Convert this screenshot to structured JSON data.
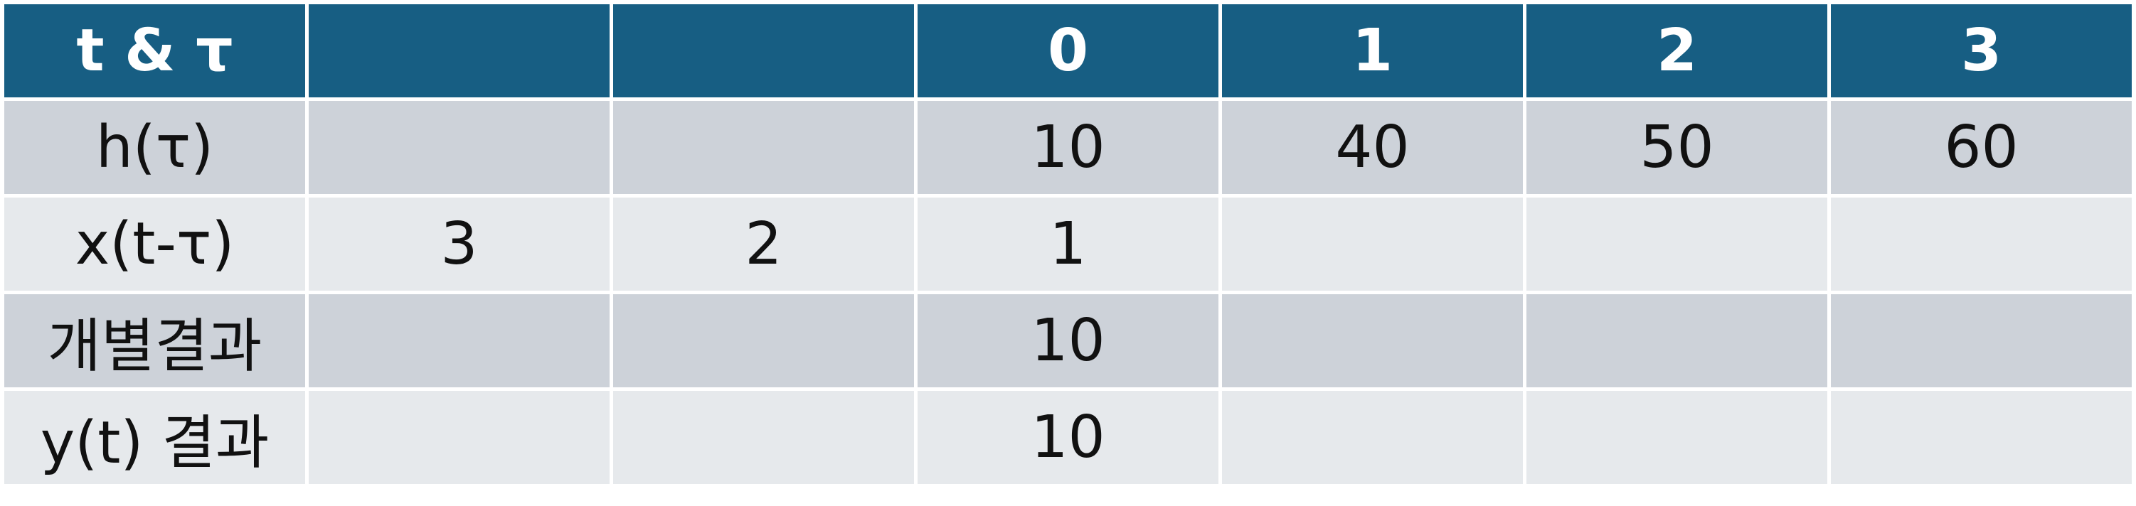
{
  "header": [
    "t & τ",
    "",
    "",
    "0",
    "1",
    "2",
    "3"
  ],
  "rows": [
    {
      "label": "h(τ)",
      "cells": [
        "",
        "",
        "10",
        "40",
        "50",
        "60"
      ]
    },
    {
      "label": "x(t-τ)",
      "cells": [
        "3",
        "2",
        "1",
        "",
        "",
        ""
      ]
    },
    {
      "label": "개별결과",
      "cells": [
        "",
        "",
        "10",
        "",
        "",
        ""
      ]
    },
    {
      "label": "y(t) 결과",
      "cells": [
        "",
        "",
        "10",
        "",
        "",
        ""
      ]
    }
  ],
  "colors": {
    "header_bg": "#175e83",
    "header_text": "#ffffff",
    "band_dark": "#cdd2d9",
    "band_light": "#e6e9ec"
  }
}
